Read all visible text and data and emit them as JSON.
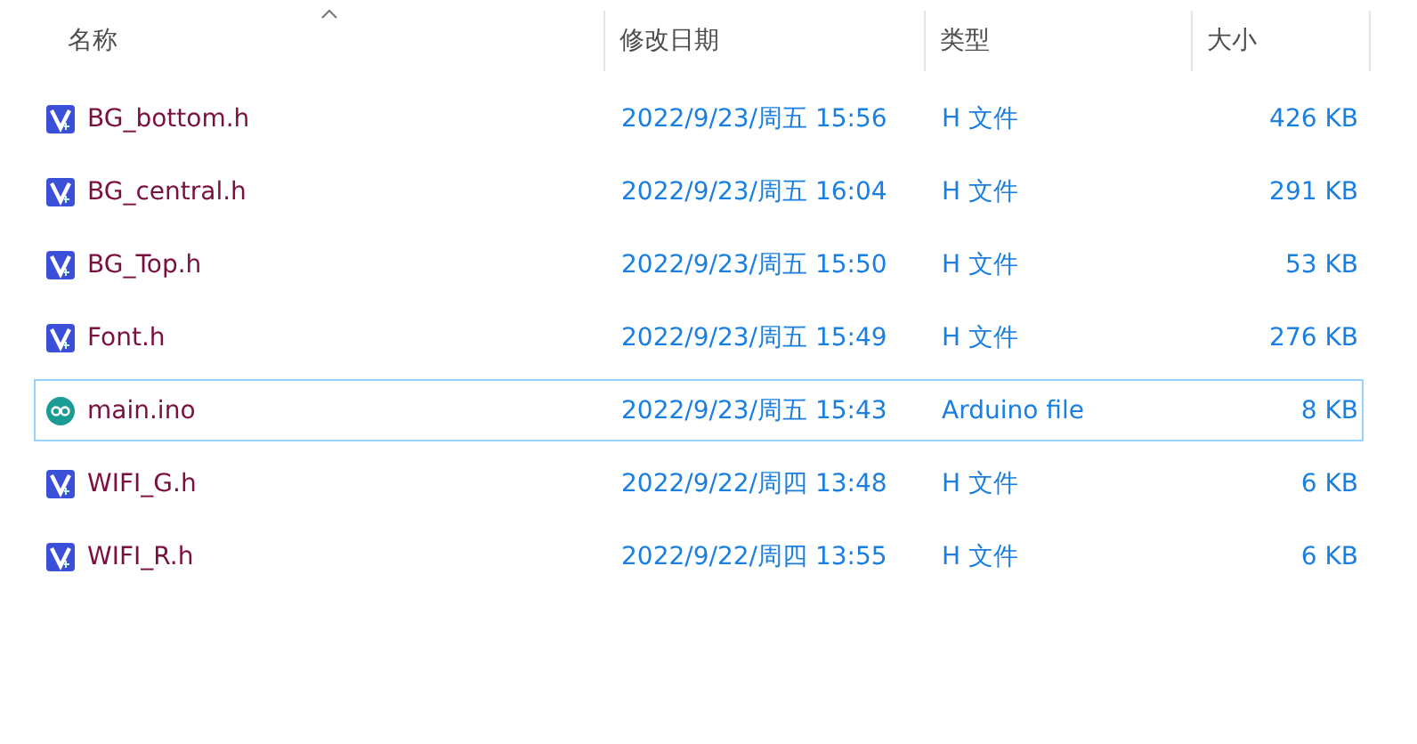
{
  "columns": [
    {
      "label": "名称",
      "sorted": true
    },
    {
      "label": "修改日期",
      "sorted": false
    },
    {
      "label": "类型",
      "sorted": false
    },
    {
      "label": "大小",
      "sorted": false
    }
  ],
  "files": [
    {
      "kind": "header",
      "name": "BG_bottom.h",
      "modified": "2022/9/23/周五 15:56",
      "type": "H 文件",
      "size": "426 KB",
      "selected": false
    },
    {
      "kind": "header",
      "name": "BG_central.h",
      "modified": "2022/9/23/周五 16:04",
      "type": "H 文件",
      "size": "291 KB",
      "selected": false
    },
    {
      "kind": "header",
      "name": "BG_Top.h",
      "modified": "2022/9/23/周五 15:50",
      "type": "H 文件",
      "size": "53 KB",
      "selected": false
    },
    {
      "kind": "header",
      "name": "Font.h",
      "modified": "2022/9/23/周五 15:49",
      "type": "H 文件",
      "size": "276 KB",
      "selected": false
    },
    {
      "kind": "arduino",
      "name": "main.ino",
      "modified": "2022/9/23/周五 15:43",
      "type": "Arduino file",
      "size": "8 KB",
      "selected": true
    },
    {
      "kind": "header",
      "name": "WIFI_G.h",
      "modified": "2022/9/22/周四 13:48",
      "type": "H 文件",
      "size": "6 KB",
      "selected": false
    },
    {
      "kind": "header",
      "name": "WIFI_R.h",
      "modified": "2022/9/22/周四 13:55",
      "type": "H 文件",
      "size": "6 KB",
      "selected": false
    }
  ]
}
